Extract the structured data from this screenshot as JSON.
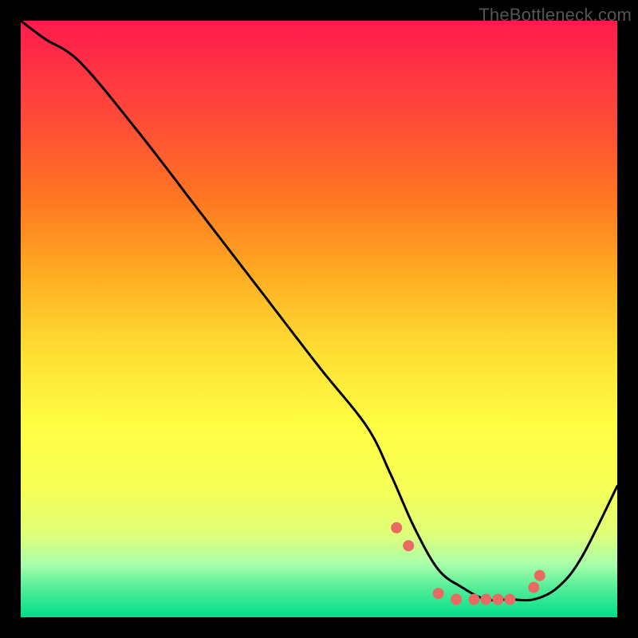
{
  "watermark": "TheBottleneck.com",
  "chart_data": {
    "type": "line",
    "title": "",
    "xlabel": "",
    "ylabel": "",
    "xlim": [
      0,
      100
    ],
    "ylim": [
      0,
      100
    ],
    "curve": {
      "name": "bottleneck-curve",
      "x": [
        0,
        4,
        10,
        20,
        30,
        40,
        50,
        58,
        62,
        66,
        70,
        74,
        78,
        82,
        86,
        90,
        94,
        100
      ],
      "y": [
        100,
        97,
        93,
        81,
        68,
        55,
        42,
        32,
        24,
        15,
        8,
        5,
        3,
        3,
        3,
        5,
        10,
        22
      ]
    },
    "markers": {
      "name": "highlight-points",
      "x": [
        63,
        65,
        70,
        73,
        76,
        78,
        80,
        82,
        86,
        87
      ],
      "y": [
        15,
        12,
        4,
        3,
        3,
        3,
        3,
        3,
        5,
        7
      ]
    }
  }
}
